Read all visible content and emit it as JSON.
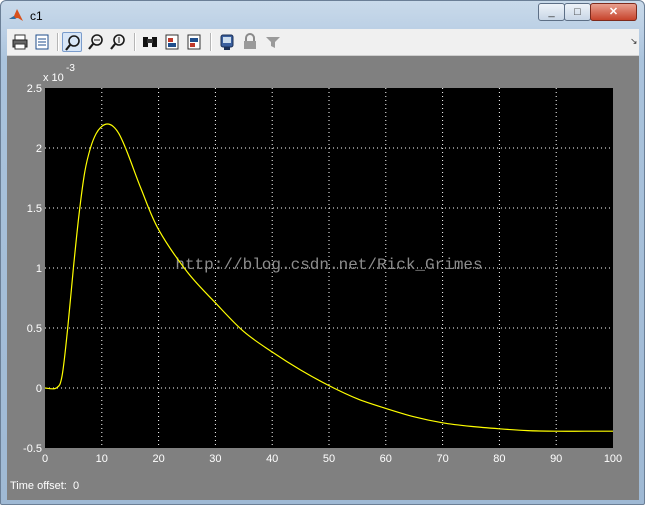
{
  "window": {
    "title": "c1",
    "minimize_label": "_",
    "maximize_label": "□",
    "close_label": "✕"
  },
  "toolbar": {
    "tools": [
      {
        "name": "print-icon"
      },
      {
        "name": "print-preview-icon"
      },
      {
        "name": "zoom-in-icon",
        "active": true
      },
      {
        "name": "zoom-x-icon"
      },
      {
        "name": "zoom-y-icon"
      },
      {
        "name": "binoculars-icon"
      },
      {
        "name": "save-axes-icon"
      },
      {
        "name": "restore-axes-icon"
      },
      {
        "name": "scope-parameters-icon"
      },
      {
        "name": "lock-icon"
      },
      {
        "name": "signal-selection-icon"
      }
    ],
    "dock_label": "↘"
  },
  "plot": {
    "background": "#000000",
    "line_color": "#ffff00",
    "watermark": "http://blog.csdn.net/Rick_Grimes",
    "exponent_label": "x 10",
    "exponent_power": "-3"
  },
  "status": {
    "offset_label": "Time offset:",
    "offset_value": "0"
  },
  "chart_data": {
    "type": "line",
    "xlim": [
      0,
      100
    ],
    "ylim": [
      -0.5,
      2.5
    ],
    "y_scale_note": "x 10^-3",
    "grid": true,
    "x_ticks": [
      0,
      10,
      20,
      30,
      40,
      50,
      60,
      70,
      80,
      90,
      100
    ],
    "y_ticks": [
      -0.5,
      0,
      0.5,
      1,
      1.5,
      2,
      2.5
    ],
    "x_tick_labels": [
      "0",
      "10",
      "20",
      "30",
      "40",
      "50",
      "60",
      "70",
      "80",
      "90",
      "100"
    ],
    "y_tick_labels": [
      "-0.5",
      "0",
      "0.5",
      "1",
      "1.5",
      "2",
      "2.5"
    ],
    "series": [
      {
        "x": [
          0,
          2,
          3,
          4,
          5,
          6,
          7,
          8,
          9,
          10,
          11,
          12,
          13,
          14,
          15,
          17,
          20,
          25,
          30,
          35,
          40,
          45,
          50,
          55,
          60,
          65,
          70,
          75,
          80,
          85,
          90,
          95,
          100
        ],
        "y": [
          0,
          0,
          0.1,
          0.5,
          1.0,
          1.45,
          1.8,
          2.0,
          2.12,
          2.18,
          2.2,
          2.18,
          2.12,
          2.02,
          1.9,
          1.65,
          1.32,
          0.97,
          0.71,
          0.47,
          0.3,
          0.15,
          0.02,
          -0.09,
          -0.17,
          -0.24,
          -0.29,
          -0.32,
          -0.34,
          -0.355,
          -0.36,
          -0.36,
          -0.36
        ]
      }
    ]
  }
}
